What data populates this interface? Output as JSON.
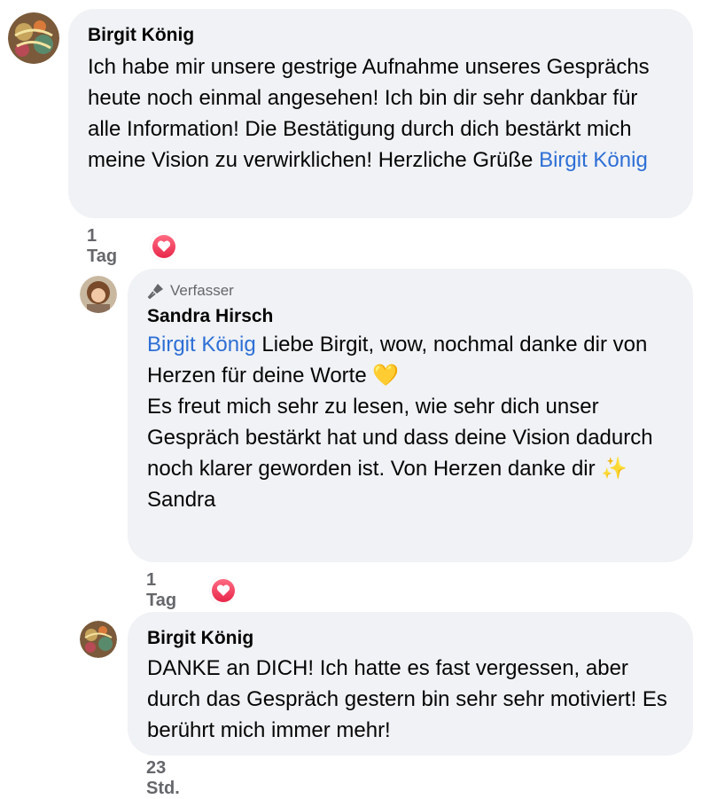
{
  "comments": [
    {
      "author": "Birgit König",
      "text": "Ich habe mir unsere gestrige Aufnahme unseres Gesprächs heute noch einmal angesehen! Ich bin dir sehr dankbar für alle Information! Die Bestätigung durch dich bestärkt mich meine Vision zu verwirklichen! Herzliche Grüße",
      "mention": "Birgit König",
      "time": "1 Tag",
      "reaction": "heart-reaction"
    },
    {
      "badge": "Verfasser",
      "author": "Sandra Hirsch",
      "mention": "Birgit König",
      "line1": "Liebe Birgit, wow, nochmal danke dir von Herzen für deine Worte",
      "emoji1": "💛",
      "line2": "Es freut mich sehr zu lesen, wie sehr dich unser Gespräch bestärkt hat und dass deine Vision dadurch noch klarer geworden ist. Von Herzen danke dir",
      "emoji2": "✨",
      "line3": "Sandra",
      "time": "1 Tag",
      "reaction": "heart-reaction"
    },
    {
      "author": "Birgit König",
      "text": "DANKE an DICH! Ich hatte es fast vergessen, aber durch das Gespräch gestern bin sehr sehr motiviert! Es berührt mich immer mehr!",
      "time": "23 Std."
    }
  ]
}
